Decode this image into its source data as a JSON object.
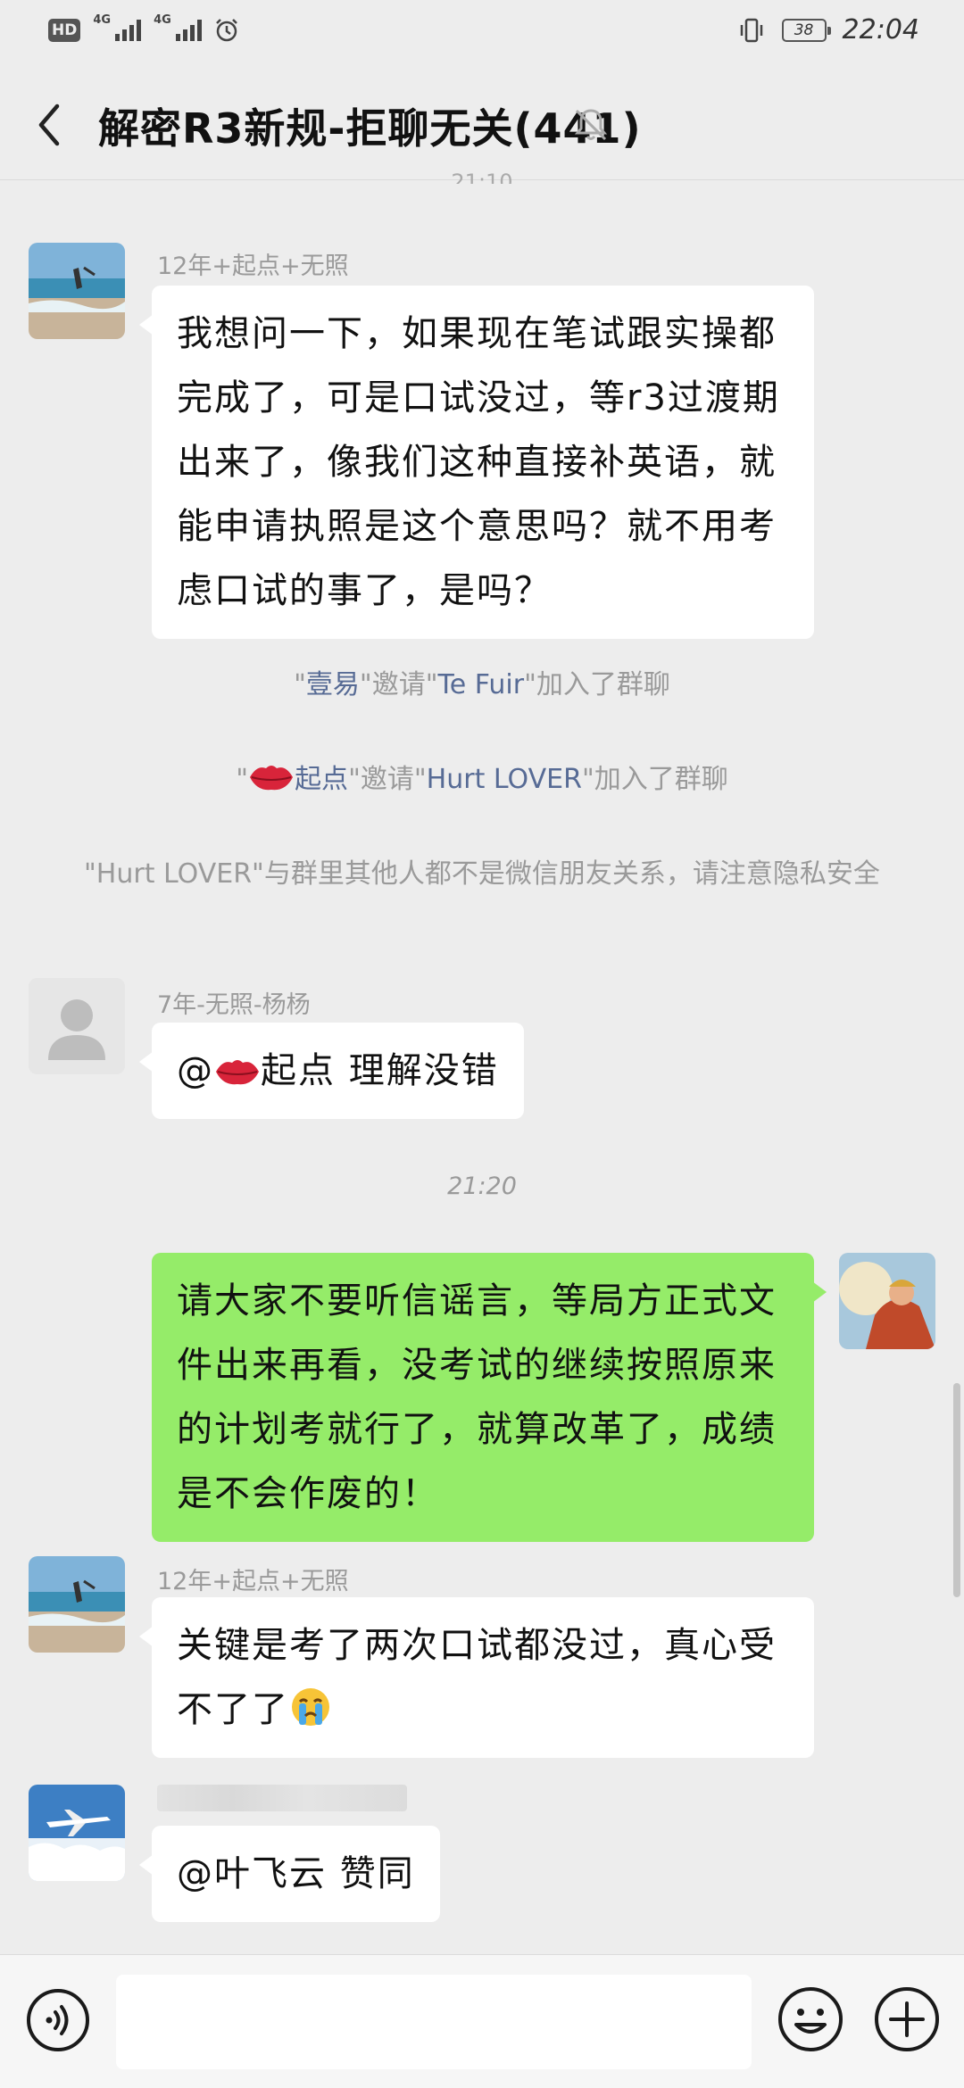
{
  "status_bar": {
    "hd": "HD",
    "net1": "4G",
    "net2": "4G",
    "battery": "38",
    "time": "22:04"
  },
  "header": {
    "title": "解密R3新规-拒聊无关(441)"
  },
  "timestamp_top": "21:10",
  "messages": [
    {
      "sender": "12年+起点+无照",
      "text": "我想问一下，如果现在笔试跟实操都完成了，可是口试没过，等r3过渡期出来了，像我们这种直接补英语，就能申请执照是这个意思吗？就不用考虑口试的事了，是吗？"
    },
    {
      "sender": "7年-无照-杨杨",
      "mention": "@",
      "mention_name": "起点",
      "text": " 理解没错"
    },
    {
      "me": true,
      "text": "请大家不要听信谣言，等局方正式文件出来再看，没考试的继续按照原来的计划考就行了，就算改革了，成绩是不会作废的！"
    },
    {
      "sender": "12年+起点+无照",
      "text": "关键是考了两次口试都没过，真心受不了了"
    },
    {
      "text": "@叶飞云  赞同"
    }
  ],
  "system": {
    "invite1_q1": "\"",
    "invite1_name": "壹易",
    "invite1_mid": "\"邀请\"",
    "invite1_name2": "Te Fuir",
    "invite1_end": "\"加入了群聊",
    "invite2_q1": "\"",
    "invite2_name": "起点",
    "invite2_mid": "\"邀请\"",
    "invite2_name2": "Hurt LOVER",
    "invite2_end": "\"加入了群聊",
    "privacy": "\"Hurt LOVER\"与群里其他人都不是微信朋友关系，请注意隐私安全"
  },
  "time_label": "21:20",
  "input_bar": {
    "placeholder": ""
  }
}
